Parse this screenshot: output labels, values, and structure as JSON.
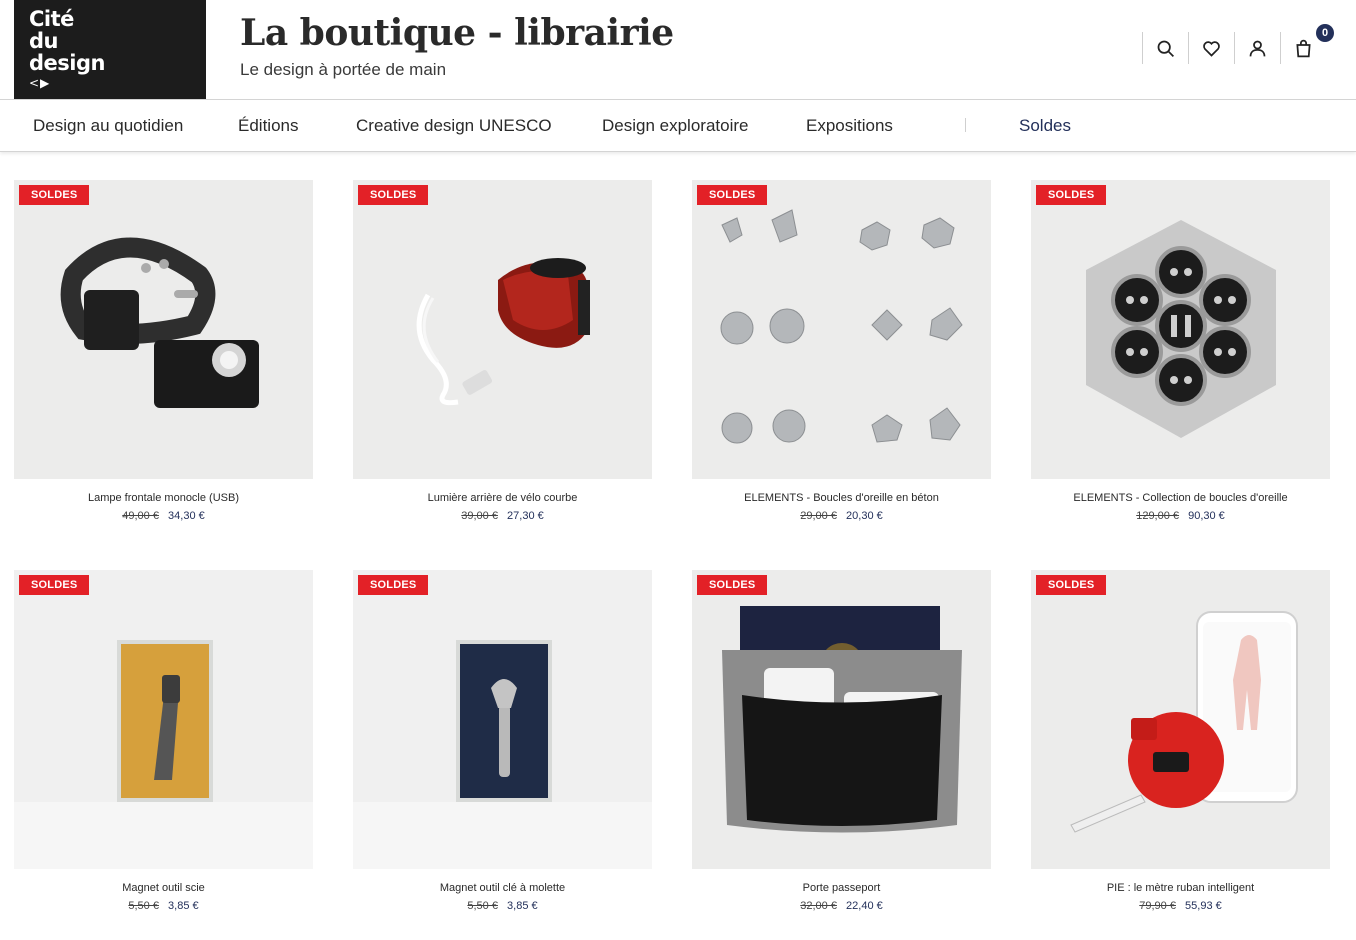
{
  "logo": {
    "text": "Cité\ndu\ndesign",
    "mark": "<▶"
  },
  "site": {
    "title": "La boutique - librairie",
    "tagline": "Le design à portée de main"
  },
  "header_icons": {
    "search": "search-icon",
    "wishlist": "heart-icon",
    "account": "user-icon",
    "cart": "bag-icon",
    "cart_count": "0"
  },
  "nav": {
    "items": [
      {
        "label": "Design au quotidien"
      },
      {
        "label": "Éditions"
      },
      {
        "label": "Creative design UNESCO"
      },
      {
        "label": "Design exploratoire"
      },
      {
        "label": "Expositions"
      },
      {
        "label": "Soldes"
      }
    ]
  },
  "colors": {
    "accent": "#23305a",
    "badge": "#e32127",
    "logo_bg": "#1c1c1c"
  },
  "products": [
    {
      "badge": "SOLDES",
      "name": "Lampe frontale monocle (USB)",
      "old_price": "49,00 €",
      "price": "34,30 €"
    },
    {
      "badge": "SOLDES",
      "name": "Lumière arrière de vélo courbe",
      "old_price": "39,00 €",
      "price": "27,30 €"
    },
    {
      "badge": "SOLDES",
      "name": "ELEMENTS - Boucles d'oreille en béton",
      "old_price": "29,00 €",
      "price": "20,30 €"
    },
    {
      "badge": "SOLDES",
      "name": "ELEMENTS - Collection de boucles d'oreille",
      "old_price": "129,00 €",
      "price": "90,30 €"
    },
    {
      "badge": "SOLDES",
      "name": "Magnet outil scie",
      "old_price": "5,50 €",
      "price": "3,85 €"
    },
    {
      "badge": "SOLDES",
      "name": "Magnet outil clé à molette",
      "old_price": "5,50 €",
      "price": "3,85 €"
    },
    {
      "badge": "SOLDES",
      "name": "Porte passeport",
      "old_price": "32,00 €",
      "price": "22,40 €"
    },
    {
      "badge": "SOLDES",
      "name": "PIE : le mètre ruban intelligent",
      "old_price": "79,90 €",
      "price": "55,93 €"
    }
  ]
}
